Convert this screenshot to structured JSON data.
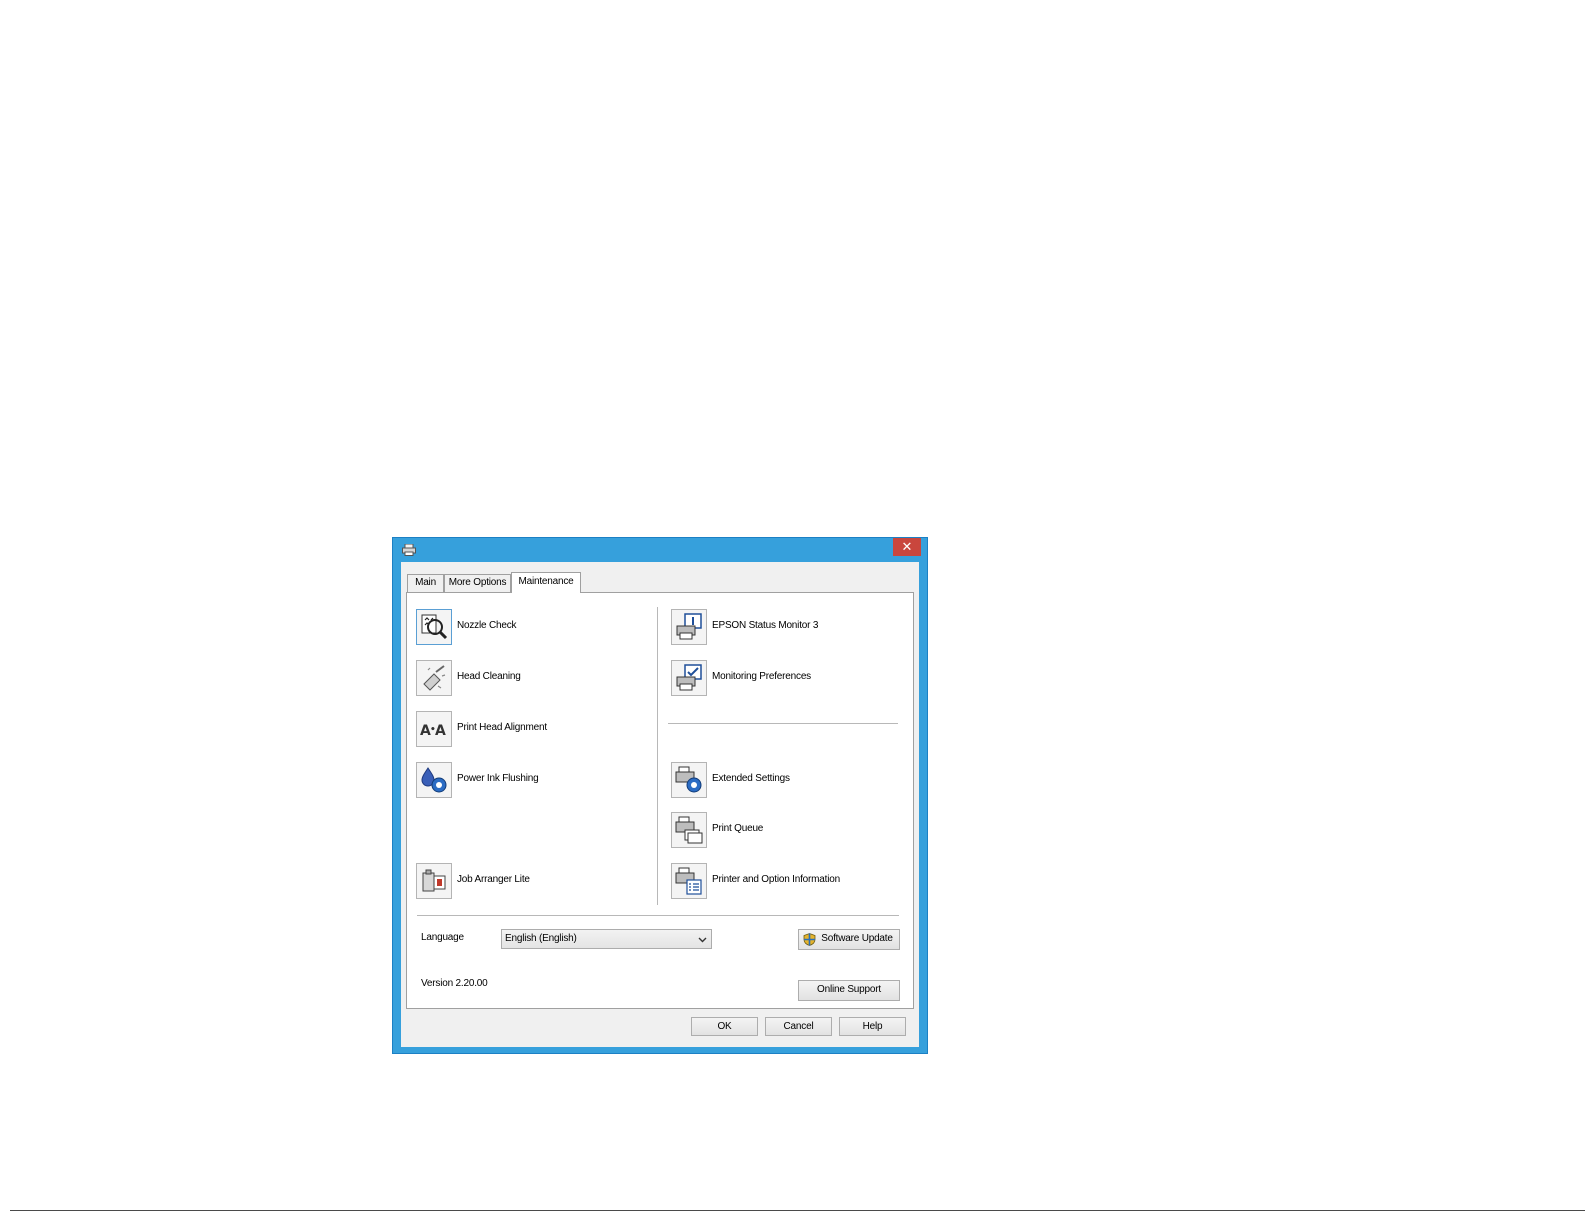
{
  "dialog": {
    "close_label": "✕",
    "tabs": [
      {
        "label": "Main",
        "active": false
      },
      {
        "label": "More Options",
        "active": false
      },
      {
        "label": "Maintenance",
        "active": true
      }
    ],
    "left_items": [
      {
        "label": "Nozzle Check",
        "icon": "nozzle-check-icon"
      },
      {
        "label": "Head Cleaning",
        "icon": "head-cleaning-icon"
      },
      {
        "label": "Print Head Alignment",
        "icon": "alignment-icon"
      },
      {
        "label": "Power Ink Flushing",
        "icon": "ink-flushing-icon"
      },
      {
        "label": "Job Arranger Lite",
        "icon": "job-arranger-icon"
      }
    ],
    "right_items": [
      {
        "label": "EPSON Status Monitor 3",
        "icon": "status-monitor-icon"
      },
      {
        "label": "Monitoring Preferences",
        "icon": "monitoring-preferences-icon"
      },
      {
        "label": "Extended Settings",
        "icon": "extended-settings-icon"
      },
      {
        "label": "Print Queue",
        "icon": "print-queue-icon"
      },
      {
        "label": "Printer and Option Information",
        "icon": "printer-info-icon"
      }
    ],
    "language_label": "Language",
    "language_value": "English (English)",
    "software_update_label": "Software Update",
    "version_label": "Version 2.20.00",
    "online_support_label": "Online Support",
    "footer": {
      "ok_label": "OK",
      "cancel_label": "Cancel",
      "help_label": "Help"
    },
    "colors": {
      "title_bar": "#36a0dc",
      "close_button": "#c9463d",
      "window_face": "#f0f0f0"
    }
  }
}
